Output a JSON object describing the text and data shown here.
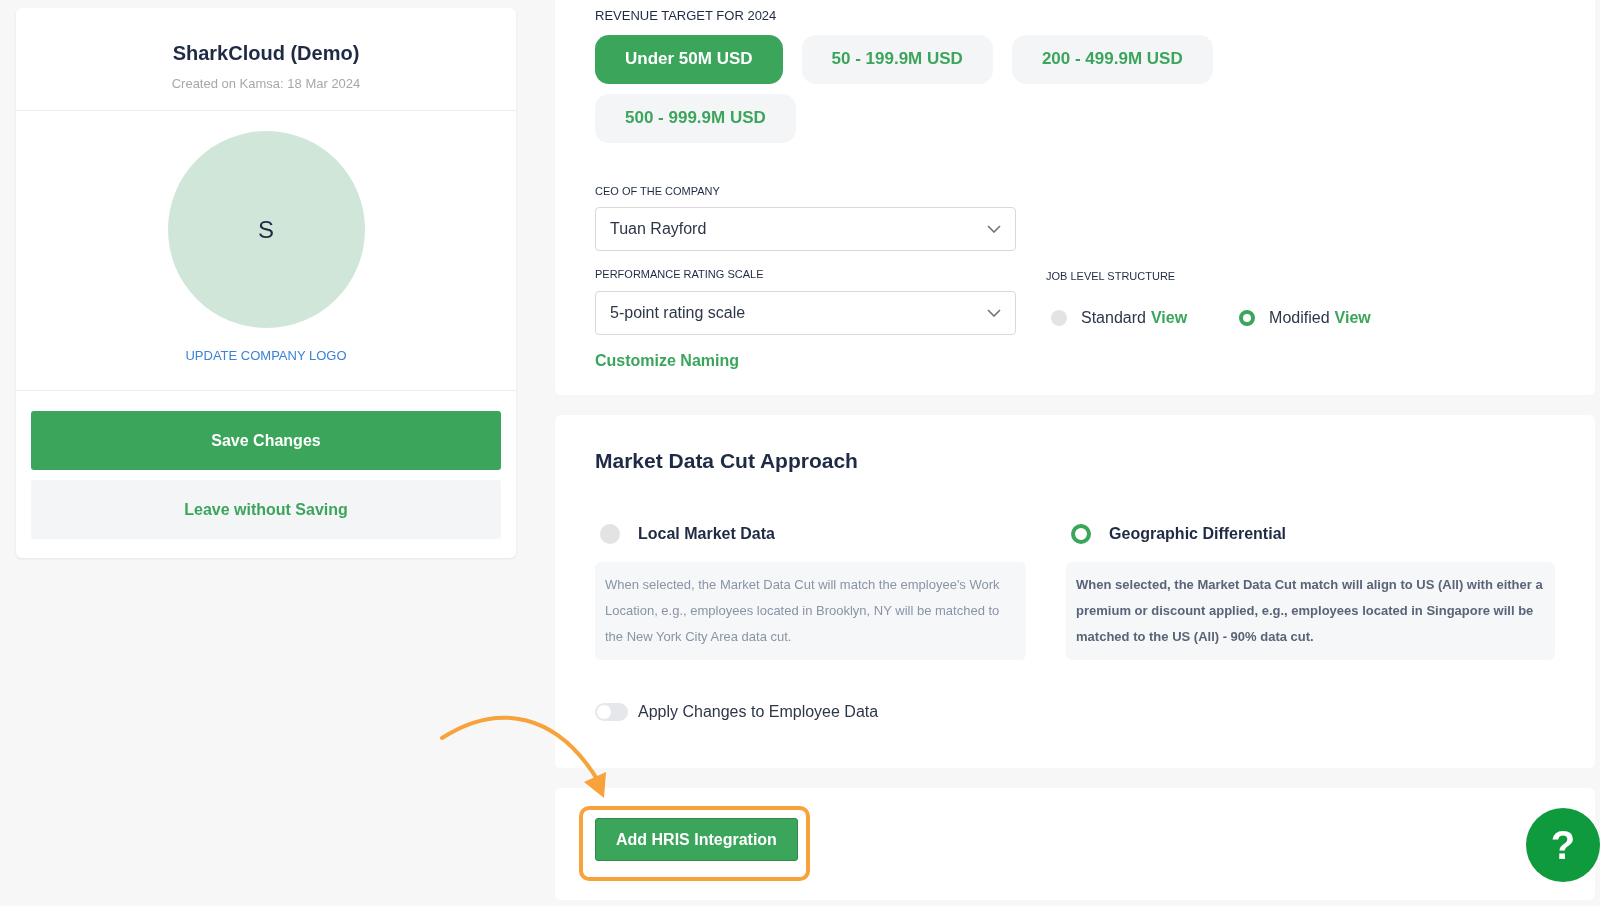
{
  "company": {
    "name": "SharkCloud (Demo)",
    "created": "Created on Kamsa: 18 Mar 2024",
    "initial": "S",
    "update_logo": "UPDATE COMPANY LOGO"
  },
  "actions": [
    {
      "kind": "primary",
      "label": "Save Changes"
    },
    {
      "kind": "secondary",
      "label": "Leave without Saving"
    }
  ],
  "revenue": {
    "label": "REVENUE TARGET FOR 2024",
    "options": [
      {
        "label": "Under 50M USD",
        "selected": true
      },
      {
        "label": "50 - 199.9M USD",
        "selected": false
      },
      {
        "label": "200 - 499.9M USD",
        "selected": false
      },
      {
        "label": "500 - 999.9M USD",
        "selected": false
      }
    ]
  },
  "ceo": {
    "label": "CEO OF THE COMPANY",
    "value": "Tuan Rayford"
  },
  "performance": {
    "label": "PERFORMANCE RATING SCALE",
    "value": "5-point rating scale"
  },
  "job_level": {
    "label": "JOB LEVEL STRUCTURE",
    "options": [
      {
        "label": "Standard",
        "link": "View",
        "selected": false
      },
      {
        "label": "Modified",
        "link": "View",
        "selected": true
      }
    ]
  },
  "customize_link": "Customize Naming",
  "market": {
    "title": "Market Data Cut Approach",
    "options": [
      {
        "label": "Local Market Data",
        "description": "When selected, the Market Data Cut will match the employee's Work Location, e.g., employees located in Brooklyn, NY will be matched to the New York City Area data cut.",
        "selected": false
      },
      {
        "label": "Geographic Differential",
        "description": "When selected, the Market Data Cut match will align to US (All) with either a premium or discount applied, e.g., employees located in Singapore will be matched to the US (All) - 90% data cut.",
        "selected": true
      }
    ],
    "toggle": {
      "label": "Apply Changes to Employee Data",
      "on": false
    }
  },
  "hris_button": {
    "label": "Add HRIS Integration",
    "highlighted": true
  },
  "help": {
    "label": "?"
  }
}
